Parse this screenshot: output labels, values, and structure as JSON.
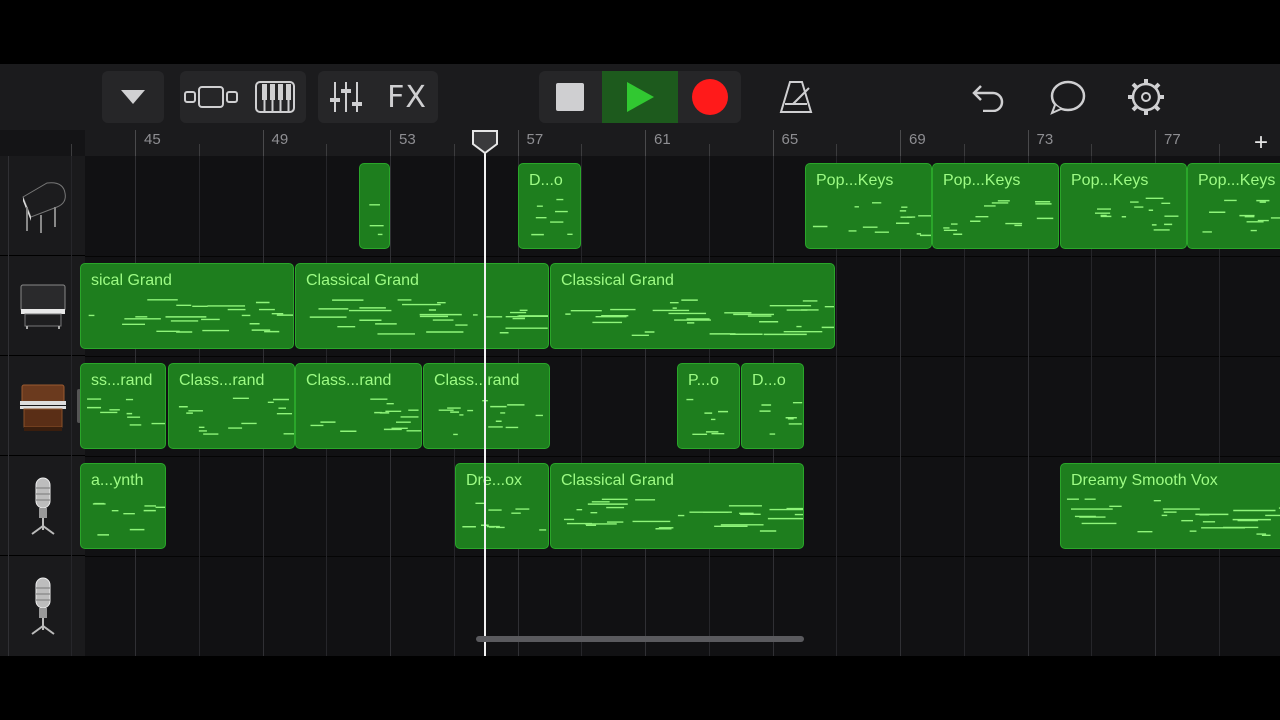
{
  "toolbar": {
    "fx_label": "FX",
    "icons": [
      "tracks-dropdown-icon",
      "track-view-icon",
      "keyboard-icon",
      "mixer-icon",
      "fx-button",
      "stop-icon",
      "play-icon",
      "record-icon",
      "metronome-icon",
      "undo-icon",
      "loop-icon",
      "settings-icon"
    ],
    "colors": {
      "play": "#31c831",
      "record": "#ff1a1a"
    }
  },
  "ruler": {
    "labels": [
      "45",
      "49",
      "53",
      "57",
      "61",
      "65",
      "69",
      "73",
      "77"
    ],
    "add_label": "+"
  },
  "tracks": [
    {
      "instrument": "grand-piano-icon"
    },
    {
      "instrument": "upright-piano-icon"
    },
    {
      "instrument": "organ-icon"
    },
    {
      "instrument": "microphone-icon"
    },
    {
      "instrument": "microphone-icon"
    }
  ],
  "regions": [
    {
      "track": 0,
      "name": ""
    },
    {
      "track": 0,
      "name": "D...o"
    },
    {
      "track": 0,
      "name": "Pop...Keys"
    },
    {
      "track": 0,
      "name": "Pop...Keys"
    },
    {
      "track": 0,
      "name": "Pop...Keys"
    },
    {
      "track": 0,
      "name": "Pop...Keys"
    },
    {
      "track": 1,
      "name": "sical Grand"
    },
    {
      "track": 1,
      "name": "Classical Grand"
    },
    {
      "track": 1,
      "name": "Classical Grand"
    },
    {
      "track": 2,
      "name": "ss...rand"
    },
    {
      "track": 2,
      "name": "Class...rand"
    },
    {
      "track": 2,
      "name": "Class...rand"
    },
    {
      "track": 2,
      "name": "Class...rand"
    },
    {
      "track": 2,
      "name": "P...o"
    },
    {
      "track": 2,
      "name": "D...o"
    },
    {
      "track": 3,
      "name": "a...ynth"
    },
    {
      "track": 3,
      "name": "Dre...ox"
    },
    {
      "track": 3,
      "name": "Classical Grand"
    },
    {
      "track": 3,
      "name": "Dreamy Smooth Vox"
    }
  ]
}
